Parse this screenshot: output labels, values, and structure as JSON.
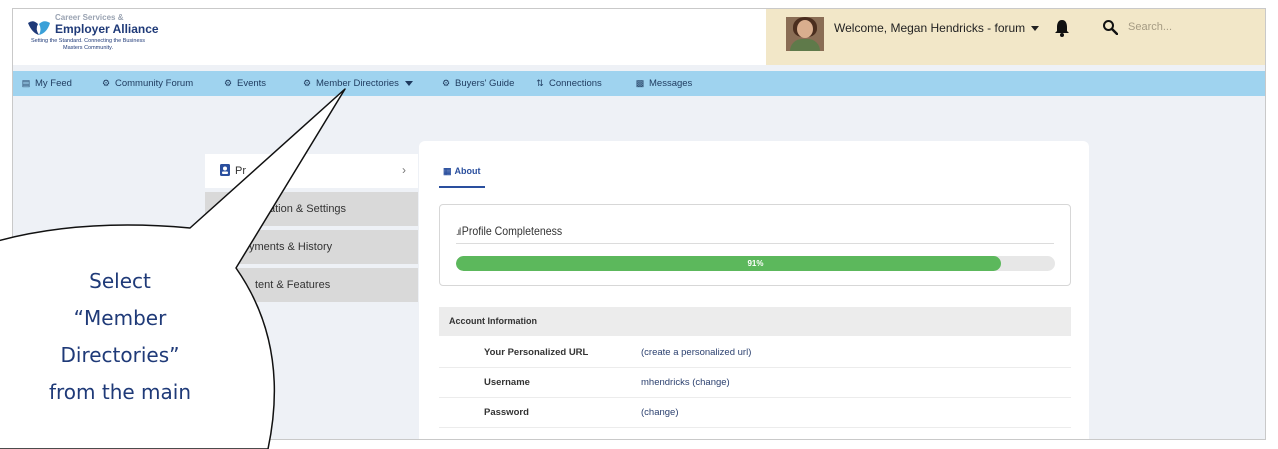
{
  "header": {
    "logo_top": "Career Services &",
    "logo_name": "Employer Alliance",
    "logo_tagline": "Setting the Standard. Connecting the Business Masters Community.",
    "welcome": "Welcome, Megan Hendricks - forum",
    "search_placeholder": "Search..."
  },
  "nav": {
    "items": [
      {
        "label": "My Feed",
        "icon": "feed-icon"
      },
      {
        "label": "Community Forum",
        "icon": "gears-icon"
      },
      {
        "label": "Events",
        "icon": "gears-icon"
      },
      {
        "label": "Member Directories",
        "icon": "gears-icon"
      },
      {
        "label": "Buyers' Guide",
        "icon": "gears-icon"
      },
      {
        "label": "Connections",
        "icon": "connections-icon"
      },
      {
        "label": "Messages",
        "icon": "messages-icon"
      }
    ]
  },
  "menu": {
    "items": [
      {
        "label": "Pr"
      },
      {
        "label": "ation & Settings"
      },
      {
        "label": "yments & History"
      },
      {
        "label": "tent & Features"
      }
    ]
  },
  "about_tab": "About",
  "profile": {
    "title": "Profile Completeness",
    "progress_label": "91%",
    "progress_value": 0.91,
    "bar_color": "#5cb85c"
  },
  "account": {
    "heading": "Account Information",
    "rows": [
      {
        "key": "Your Personalized URL",
        "value": "(create a personalized url)"
      },
      {
        "key": "Username",
        "value": "mhendricks (change)"
      },
      {
        "key": "Password",
        "value": "(change)"
      }
    ]
  },
  "callout": {
    "lines": [
      "Select",
      "“Member",
      "Directories”",
      "from the main"
    ]
  },
  "colors": {
    "nav_bg": "#9fd3ef",
    "userbox_bg": "#f2e7c8",
    "brand_blue": "#1f3a78"
  }
}
